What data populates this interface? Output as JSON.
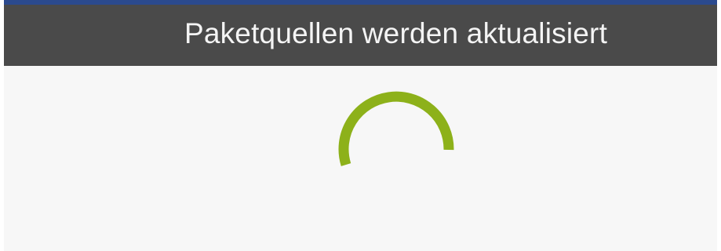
{
  "dialog": {
    "title": "Paketquellen werden aktualisiert"
  },
  "spinner": {
    "icon": "loading-spinner-icon",
    "color": "#8db11a"
  },
  "colors": {
    "titlebar_background": "#4a4a4a",
    "top_strip": "#2b4a8e",
    "content_background": "#f7f7f7",
    "title_text": "#f4f4f4"
  }
}
